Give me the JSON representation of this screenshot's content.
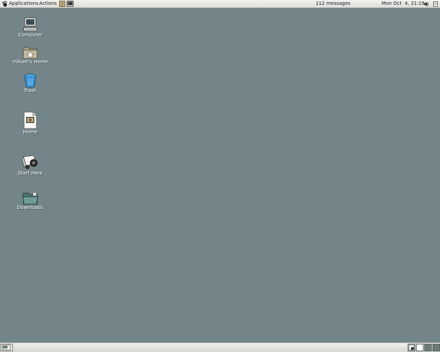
{
  "top_panel": {
    "menus": {
      "applications": "Applications",
      "actions": "Actions"
    },
    "launchers": [
      "text-editor-icon",
      "terminal-icon"
    ],
    "mail_status": "112 messages",
    "clock": "Mon Oct  4, 21:19"
  },
  "desktop": {
    "background_color": "#738589",
    "icons": [
      {
        "label": "Computer",
        "icon": "computer-icon"
      },
      {
        "label": "mikael's Home",
        "icon": "home-folder-icon"
      },
      {
        "label": "Trash",
        "icon": "trash-icon"
      },
      {
        "label": "Home",
        "icon": "home-file-icon"
      },
      {
        "label": "Start Here",
        "icon": "start-here-icon"
      },
      {
        "label": "Downloads",
        "icon": "downloads-folder-icon"
      }
    ]
  },
  "bottom_panel": {
    "workspaces": 4,
    "active_workspace": 1
  }
}
